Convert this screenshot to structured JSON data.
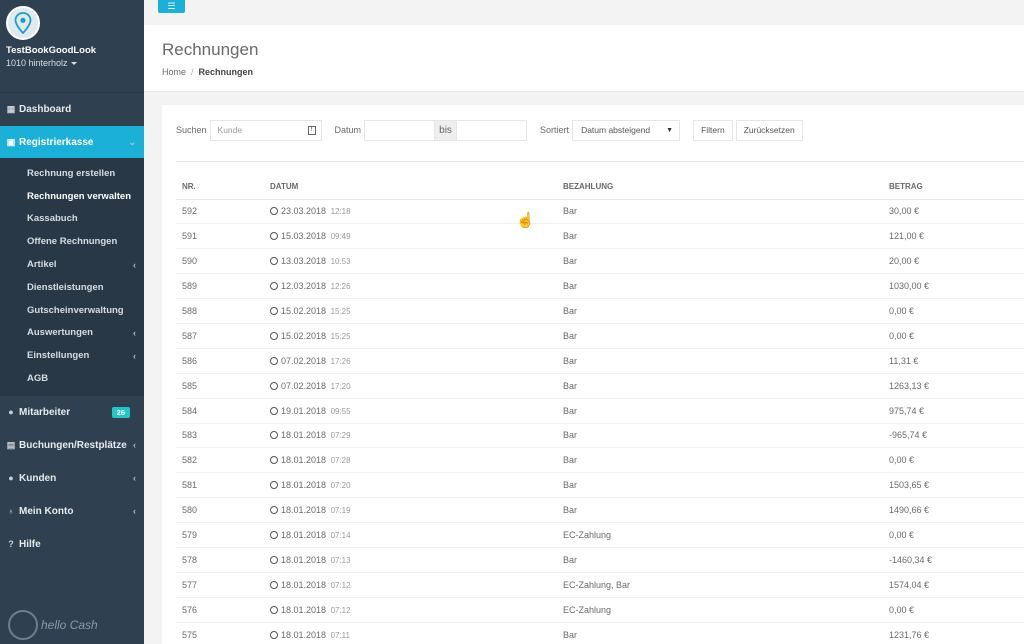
{
  "sidebar": {
    "shop_name": "TestBookGoodLook",
    "shop_sub": "1010 hinterholz",
    "brand": "hello Cash",
    "items": {
      "dashboard": "Dashboard",
      "registrierkasse": "Registrierkasse",
      "mitarbeiter": "Mitarbeiter",
      "mitarbeiter_badge": "26",
      "buchungen": "Buchungen/Restplätze",
      "kunden": "Kunden",
      "mein_konto": "Mein Konto",
      "hilfe": "Hilfe"
    },
    "sub_items": [
      "Rechnung erstellen",
      "Rechnungen verwalten",
      "Kassabuch",
      "Offene Rechnungen",
      "Artikel",
      "Dienstleistungen",
      "Gutscheinverwaltung",
      "Auswertungen",
      "Einstellungen",
      "AGB"
    ]
  },
  "header": {
    "title": "Rechnungen",
    "breadcrumb_home": "Home",
    "breadcrumb_current": "Rechnungen"
  },
  "filters": {
    "search_label": "Suchen",
    "search_placeholder": "Kunde",
    "date_label": "Datum",
    "date_to": "bis",
    "sort_label": "Sortiert",
    "sort_value": "Datum absteigend",
    "filter_button": "Filtern",
    "reset_button": "Zurücksetzen"
  },
  "table": {
    "headers": [
      "NR.",
      "DATUM",
      "BEZAHLUNG",
      "BETRAG"
    ],
    "rows": [
      {
        "nr": "592",
        "date": "23.03.2018",
        "time": "12:18",
        "payment": "Bar",
        "amount": "30,00 €"
      },
      {
        "nr": "591",
        "date": "15.03.2018",
        "time": "09:49",
        "payment": "Bar",
        "amount": "121,00 €"
      },
      {
        "nr": "590",
        "date": "13.03.2018",
        "time": "10:53",
        "payment": "Bar",
        "amount": "20,00 €"
      },
      {
        "nr": "589",
        "date": "12.03.2018",
        "time": "12:26",
        "payment": "Bar",
        "amount": "1030,00 €"
      },
      {
        "nr": "588",
        "date": "15.02.2018",
        "time": "15:25",
        "payment": "Bar",
        "amount": "0,00 €"
      },
      {
        "nr": "587",
        "date": "15.02.2018",
        "time": "15:25",
        "payment": "Bar",
        "amount": "0,00 €"
      },
      {
        "nr": "586",
        "date": "07.02.2018",
        "time": "17:26",
        "payment": "Bar",
        "amount": "11,31 €"
      },
      {
        "nr": "585",
        "date": "07.02.2018",
        "time": "17:20",
        "payment": "Bar",
        "amount": "1263,13 €"
      },
      {
        "nr": "584",
        "date": "19.01.2018",
        "time": "09:55",
        "payment": "Bar",
        "amount": "975,74 €"
      },
      {
        "nr": "583",
        "date": "18.01.2018",
        "time": "07:29",
        "payment": "Bar",
        "amount": "-965,74 €"
      },
      {
        "nr": "582",
        "date": "18.01.2018",
        "time": "07:28",
        "payment": "Bar",
        "amount": "0,00 €"
      },
      {
        "nr": "581",
        "date": "18.01.2018",
        "time": "07:20",
        "payment": "Bar",
        "amount": "1503,65 €"
      },
      {
        "nr": "580",
        "date": "18.01.2018",
        "time": "07:19",
        "payment": "Bar",
        "amount": "1490,66 €"
      },
      {
        "nr": "579",
        "date": "18.01.2018",
        "time": "07:14",
        "payment": "EC-Zahlung",
        "amount": "0,00 €"
      },
      {
        "nr": "578",
        "date": "18.01.2018",
        "time": "07:13",
        "payment": "Bar",
        "amount": "-1460,34 €"
      },
      {
        "nr": "577",
        "date": "18.01.2018",
        "time": "07:12",
        "payment": "EC-Zahlung, Bar",
        "amount": "1574,04 €"
      },
      {
        "nr": "576",
        "date": "18.01.2018",
        "time": "07:12",
        "payment": "EC-Zahlung",
        "amount": "0,00 €"
      },
      {
        "nr": "575",
        "date": "18.01.2018",
        "time": "07:11",
        "payment": "Bar",
        "amount": "1231,76 €"
      }
    ]
  },
  "colors": {
    "accent": "#1ab0d8",
    "sidebar_bg": "#2f4050",
    "badge": "#23c6c8"
  }
}
